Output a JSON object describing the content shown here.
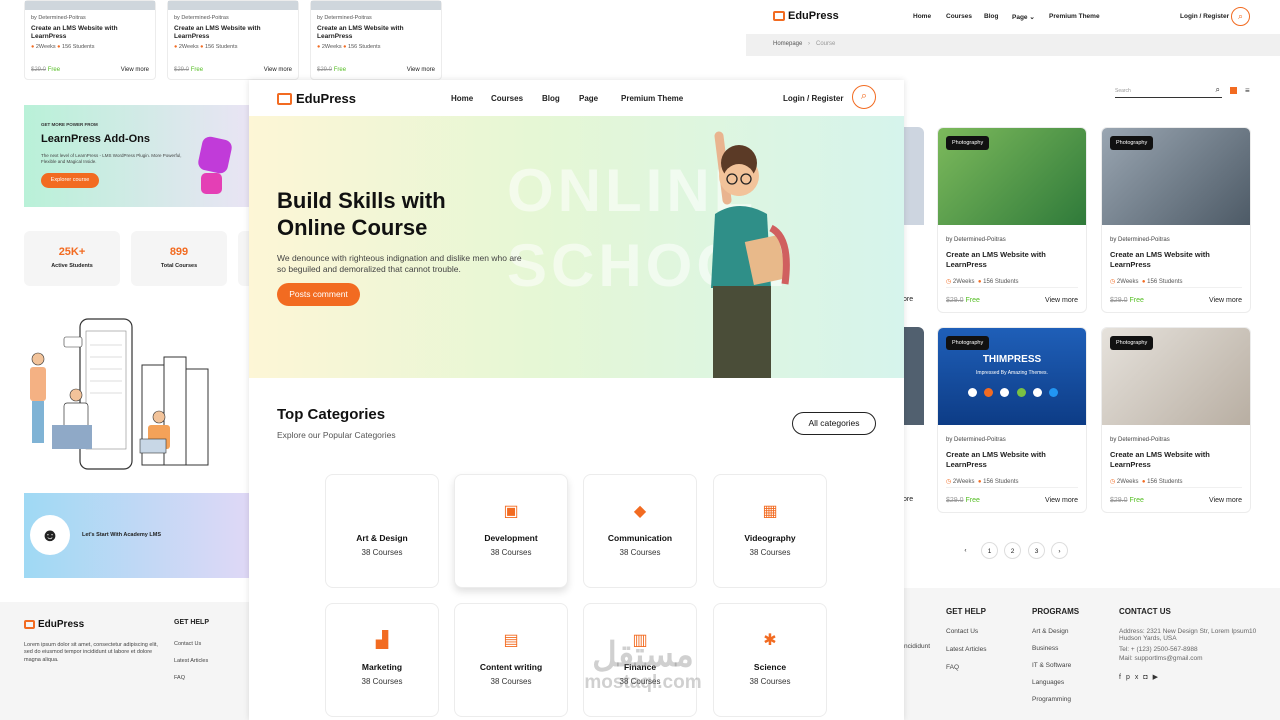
{
  "brand": {
    "name": "EduPress"
  },
  "top_cards": [
    {
      "by": "by Determined-Poitras",
      "title": "Create an LMS Website with LearnPress",
      "weeks": "2Weeks",
      "students": "156 Students",
      "old": "$29.0",
      "price": "Free",
      "link": "View more"
    },
    {
      "by": "by Determined-Poitras",
      "title": "Create an LMS Website with LearnPress",
      "weeks": "2Weeks",
      "students": "156 Students",
      "old": "$29.0",
      "price": "Free",
      "link": "View more"
    },
    {
      "by": "by Determined-Poitras",
      "title": "Create an LMS Website with LearnPress",
      "weeks": "2Weeks",
      "students": "156 Students",
      "old": "$29.0",
      "price": "Free",
      "link": "View more"
    }
  ],
  "addons": {
    "kicker": "GET MORE POWER FROM",
    "title": "LearnPress Add-Ons",
    "desc": "The next level of LearnPress - LMS WordPress Plugin. More Powerful, Flexible and Magical Inside.",
    "button": "Explorer course"
  },
  "stats": [
    {
      "num": "25K+",
      "label": "Active Students"
    },
    {
      "num": "899",
      "label": "Total Courses"
    }
  ],
  "academy": {
    "text": "Let's Start With Academy LMS"
  },
  "left_footer": {
    "desc": "Lorem ipsum dolor sit amet, consectetur adipiscing elit, sed do eiusmod tempor incididunt ut labore et dolore magna aliqua.",
    "get_help": "GET HELP",
    "links": [
      "Contact Us",
      "Latest Articles",
      "FAQ"
    ]
  },
  "main": {
    "nav": [
      "Home",
      "Courses",
      "Blog",
      "Page",
      "Premium Theme"
    ],
    "login": "Login / Register",
    "hero_title_1": "Build Skills with",
    "hero_title_2": "Online Course",
    "hero_desc_1": "We denounce with righteous indignation and dislike men who are",
    "hero_desc_2": "so beguiled and demoralized that cannot trouble.",
    "hero_button": "Posts comment",
    "hero_watermark_1": "ONLINE",
    "hero_watermark_2": "SCHOOL",
    "categories_title": "Top Categories",
    "categories_sub": "Explore our Popular Categories",
    "all_categories": "All categories",
    "categories": [
      {
        "name": "Art & Design",
        "count": "38 Courses",
        "icon": "palette-icon"
      },
      {
        "name": "Development",
        "count": "38 Courses",
        "icon": "code-icon"
      },
      {
        "name": "Communication",
        "count": "38 Courses",
        "icon": "chat-icon"
      },
      {
        "name": "Videography",
        "count": "38 Courses",
        "icon": "video-icon"
      },
      {
        "name": "Marketing",
        "count": "38 Courses",
        "icon": "chart-icon"
      },
      {
        "name": "Content writing",
        "count": "38 Courses",
        "icon": "document-icon"
      },
      {
        "name": "Finance",
        "count": "38 Courses",
        "icon": "money-icon"
      },
      {
        "name": "Science",
        "count": "38 Courses",
        "icon": "atom-icon"
      }
    ]
  },
  "right": {
    "nav": [
      "Home",
      "Courses",
      "Blog",
      "Page",
      "Premium Theme"
    ],
    "login": "Login / Register",
    "breadcrumb": [
      "Homepage",
      "Course"
    ],
    "search_placeholder": "Search",
    "courses": [
      {
        "tag": "Photography",
        "by": "by Determined-Poitras",
        "title": "Create an LMS Website with LearnPress",
        "weeks": "2Weeks",
        "students": "156 Students",
        "old": "$29.0",
        "price": "Free",
        "link": "View more"
      },
      {
        "tag": "Photography",
        "by": "by Determined-Poitras",
        "title": "Create an LMS Website with LearnPress",
        "weeks": "2Weeks",
        "students": "156 Students",
        "old": "$29.0",
        "price": "Free",
        "link": "View more"
      },
      {
        "tag": "Photography",
        "by": "by Determined-Poitras",
        "title": "Create an LMS Website with LearnPress",
        "weeks": "2Weeks",
        "students": "156 Students",
        "old": "$29.0",
        "price": "Free",
        "link": "View more"
      },
      {
        "tag": "Photography",
        "by": "by Determined-Poitras",
        "title": "Create an LMS Website with LearnPress",
        "weeks": "2Weeks",
        "students": "156 Students",
        "old": "$29.0",
        "price": "Free",
        "link": "View more"
      }
    ],
    "partial_more": "ore",
    "thimpress": "THIMPRESS",
    "thimpress_sub": "Impressed By Amazing Themes.",
    "pages": [
      "1",
      "2",
      "3"
    ],
    "footer": {
      "partial": "ncididunt",
      "get_help": "GET HELP",
      "help_links": [
        "Contact Us",
        "Latest Articles",
        "FAQ"
      ],
      "programs": "PROGRAMS",
      "program_links": [
        "Art & Design",
        "Business",
        "IT & Software",
        "Languages",
        "Programming"
      ],
      "contact": "CONTACT US",
      "address": "Address: 2321 New Design Str, Lorem Ipsum10 Hudson Yards, USA",
      "tel": "Tel: + (123) 2500-567-8988",
      "mail": "Mail: supportlms@gmail.com"
    }
  },
  "watermark": {
    "arabic": "مستقل",
    "latin": "mostaql.com"
  },
  "colors": {
    "accent": "#f26b21",
    "free": "#55be24"
  }
}
